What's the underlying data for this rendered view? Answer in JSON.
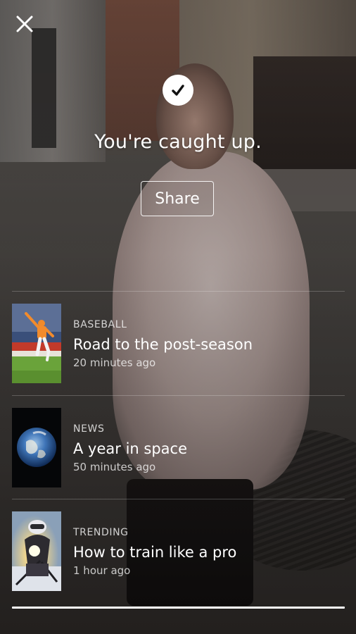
{
  "header": {
    "close_icon": "close-icon",
    "check_icon": "checkmark-icon",
    "title": "You're caught up.",
    "share_label": "Share"
  },
  "stories": [
    {
      "category": "BASEBALL",
      "headline": "Road to the post-season",
      "time": "20 minutes ago",
      "thumbnail": "baseball-player-thumbnail"
    },
    {
      "category": "NEWS",
      "headline": "A year in space",
      "time": "50 minutes ago",
      "thumbnail": "earth-from-space-thumbnail"
    },
    {
      "category": "TRENDING",
      "headline": "How to train like a pro",
      "time": "1 hour ago",
      "thumbnail": "skier-thumbnail"
    }
  ],
  "colors": {
    "text": "#ffffff",
    "secondary_text": "#d9d9d9",
    "divider": "#ffffff"
  }
}
